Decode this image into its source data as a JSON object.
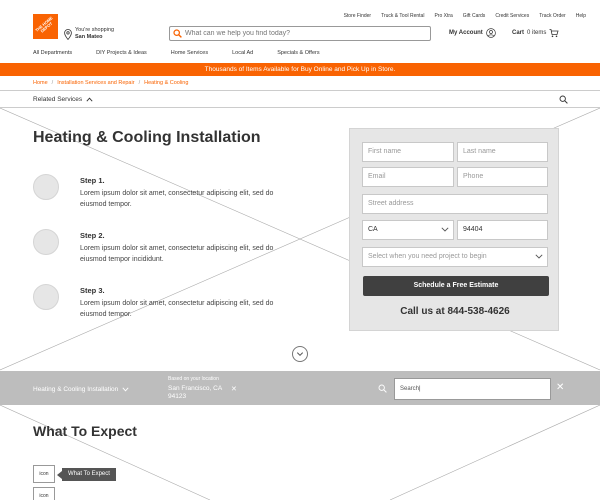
{
  "header": {
    "logo_text": "THE HOME DEPOT",
    "utility_links": [
      "Store Finder",
      "Truck & Tool Rental",
      "Pro Xtra",
      "Gift Cards",
      "Credit Services",
      "Track Order",
      "Help"
    ],
    "store_label": "You're shopping",
    "store_name": "San Mateo",
    "search_placeholder": "What can we help you find today?",
    "account_label": "My Account",
    "cart_label": "Cart",
    "cart_count": "0 items"
  },
  "nav": {
    "items": [
      "All Departments",
      "DIY Projects & Ideas",
      "Home Services",
      "Local Ad",
      "Specials & Offers"
    ]
  },
  "banner": {
    "text": "Thousands of Items Available for Buy Online and Pick Up in Store."
  },
  "breadcrumb": [
    "Home",
    "Installation Services and Repair",
    "Heating & Cooling"
  ],
  "related": {
    "label": "Related Services"
  },
  "main": {
    "title": "Heating & Cooling Installation",
    "steps": [
      {
        "title": "Step 1.",
        "text": "Lorem ipsum dolor sit amet, consectetur adipiscing elit, sed do eiusmod tempor."
      },
      {
        "title": "Step 2.",
        "text": "Lorem ipsum dolor sit amet, consectetur adipiscing elit, sed do eiusmod tempor incididunt."
      },
      {
        "title": "Step 3.",
        "text": "Lorem ipsum dolor sit amet, consectetur adipiscing elit, sed do eiusmod tempor."
      }
    ]
  },
  "form": {
    "first_name": "First name",
    "last_name": "Last name",
    "email": "Email",
    "phone": "Phone",
    "street": "Street address",
    "state": "CA",
    "zip": "94404",
    "timeline": "Select when you need project to begin",
    "submit": "Schedule a Free Estimate",
    "call": "Call us at 844-538-4626"
  },
  "sticky": {
    "service": "Heating & Cooling Installation",
    "based_label": "Based on your location",
    "location_line1": "San Francisco, CA",
    "location_line2": "94123",
    "search_value": "Search"
  },
  "expect": {
    "title": "What To Expect",
    "icon_label": "icon",
    "tooltip": "What To Expect"
  }
}
